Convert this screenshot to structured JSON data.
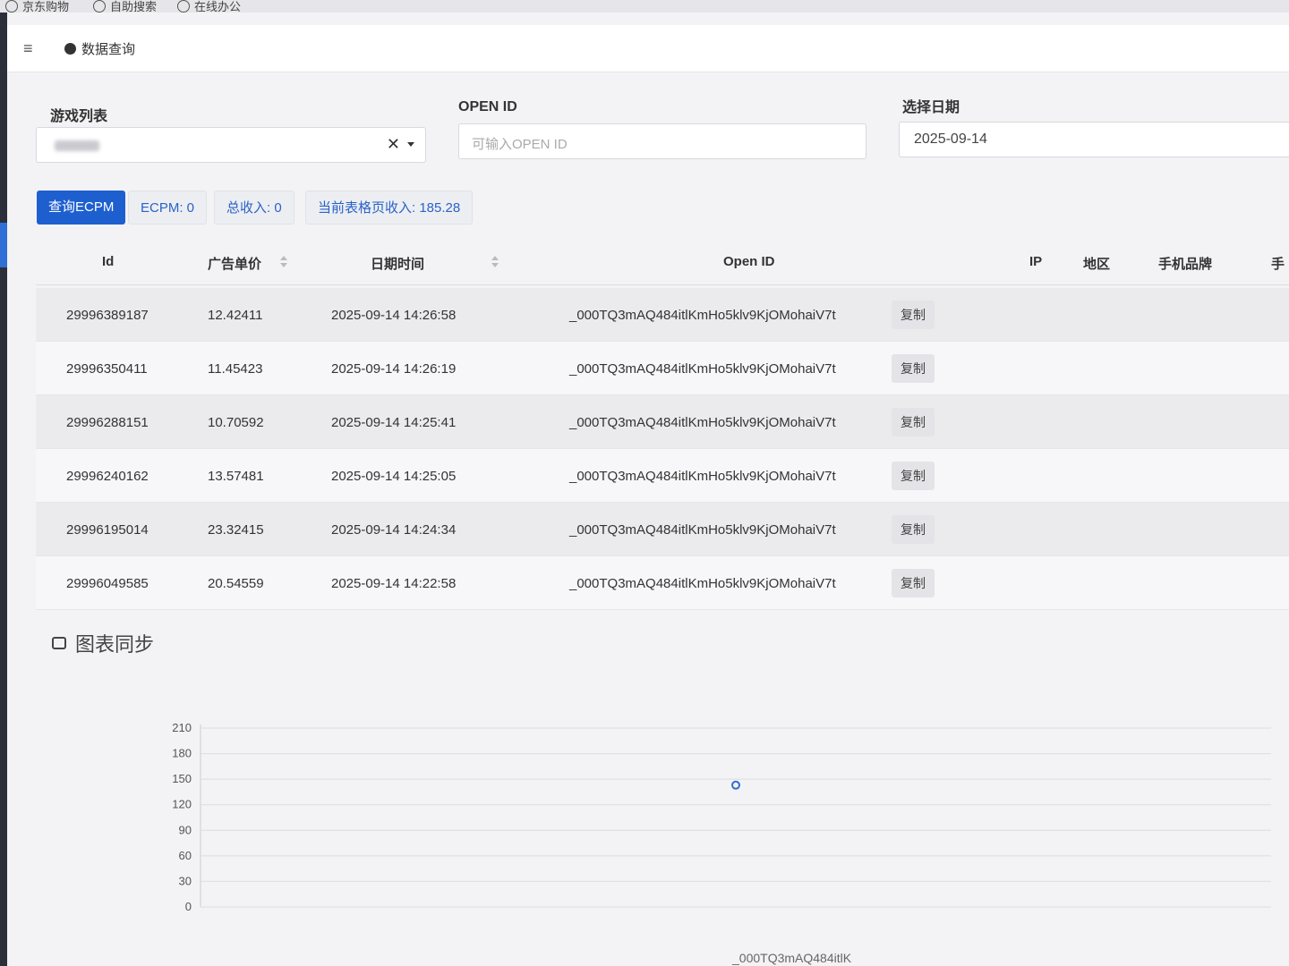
{
  "browser": {
    "bookmarks": [
      {
        "label": "京东购物"
      },
      {
        "label": "自助搜索"
      },
      {
        "label": "在线办公"
      }
    ]
  },
  "nav": {
    "menu_icon": "hamburger-icon",
    "title": "数据查询"
  },
  "filters": {
    "game_list": {
      "label": "游戏列表",
      "value": ""
    },
    "open_id": {
      "label": "OPEN ID",
      "placeholder": "可输入OPEN ID"
    },
    "date": {
      "label": "选择日期",
      "value": "2025-09-14"
    }
  },
  "actions": {
    "query_button": "查询ECPM",
    "ecpm": "ECPM: 0",
    "total_income": "总收入: 0",
    "page_income": "当前表格页收入: 185.28"
  },
  "table": {
    "headers": {
      "id": "Id",
      "price": "广告单价",
      "datetime": "日期时间",
      "open_id": "Open ID",
      "ip": "IP",
      "region": "地区",
      "brand": "手机品牌",
      "extra": "手"
    },
    "copy_label": "复制",
    "rows": [
      {
        "id": "29996389187",
        "price": "12.42411",
        "datetime": "2025-09-14 14:26:58",
        "open_id": "_000TQ3mAQ484itlKmHo5klv9KjOMohaiV7t"
      },
      {
        "id": "29996350411",
        "price": "11.45423",
        "datetime": "2025-09-14 14:26:19",
        "open_id": "_000TQ3mAQ484itlKmHo5klv9KjOMohaiV7t"
      },
      {
        "id": "29996288151",
        "price": "10.70592",
        "datetime": "2025-09-14 14:25:41",
        "open_id": "_000TQ3mAQ484itlKmHo5klv9KjOMohaiV7t"
      },
      {
        "id": "29996240162",
        "price": "13.57481",
        "datetime": "2025-09-14 14:25:05",
        "open_id": "_000TQ3mAQ484itlKmHo5klv9KjOMohaiV7t"
      },
      {
        "id": "29996195014",
        "price": "23.32415",
        "datetime": "2025-09-14 14:24:34",
        "open_id": "_000TQ3mAQ484itlKmHo5klv9KjOMohaiV7t"
      },
      {
        "id": "29996049585",
        "price": "20.54559",
        "datetime": "2025-09-14 14:22:58",
        "open_id": "_000TQ3mAQ484itlKmHo5klv9KjOMohaiV7t"
      }
    ]
  },
  "chart_section": {
    "title": "图表同步",
    "icon": "chart-icon"
  },
  "chart_data": {
    "type": "scatter",
    "title": "",
    "xlabel": "",
    "ylabel": "",
    "y_ticks": [
      0,
      30,
      60,
      90,
      120,
      150,
      180,
      210
    ],
    "ylim": [
      0,
      210
    ],
    "grid": true,
    "points": [
      {
        "x": 0.5,
        "y": 143
      }
    ],
    "x_label_partial": "_000TQ3mAQ484itlK"
  },
  "colors": {
    "primary": "#1e5fd0",
    "info_text": "#2a62c8",
    "point": "#2f6fd6"
  }
}
